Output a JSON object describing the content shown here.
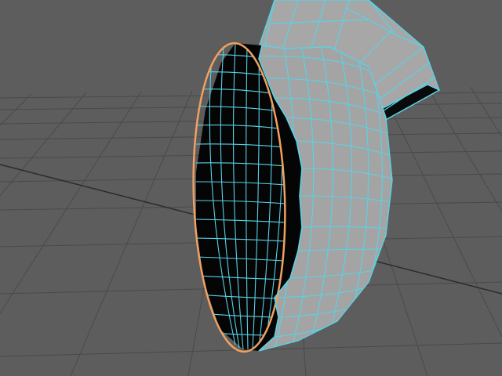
{
  "viewport": {
    "type": "3d-modeling-perspective-view",
    "background_color": "#5d5d5d",
    "grid_color": "#4a4a4a",
    "grid_axis_color": "#2b2b2b",
    "mesh": {
      "object": "cut-open-hemisphere-shell-with-tube",
      "shaded_color": "#a4a4a4",
      "wireframe_color": "#57d3e6",
      "inner_cavity_color": "#050505",
      "selected_edge_color": "#f0a062",
      "selected_edge_loop": "open-rim-border"
    }
  }
}
